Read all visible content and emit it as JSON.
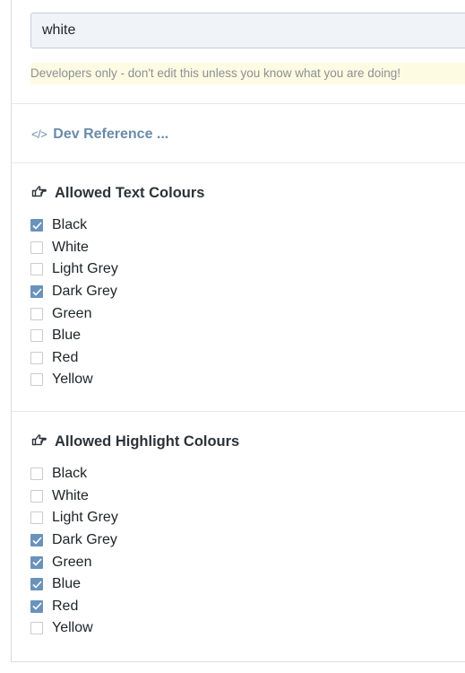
{
  "field": {
    "value": "white",
    "developer_note": "Developers only - don't edit this unless you know what you are doing!"
  },
  "dev_reference": {
    "icon": "code-icon",
    "glyph": "</>",
    "label": "Dev Reference ..."
  },
  "text_colours": {
    "icon": "hand-pointing-icon",
    "title": "Allowed Text Colours",
    "options": [
      {
        "label": "Black",
        "checked": true
      },
      {
        "label": "White",
        "checked": false
      },
      {
        "label": "Light Grey",
        "checked": false
      },
      {
        "label": "Dark Grey",
        "checked": true
      },
      {
        "label": "Green",
        "checked": false
      },
      {
        "label": "Blue",
        "checked": false
      },
      {
        "label": "Red",
        "checked": false
      },
      {
        "label": "Yellow",
        "checked": false
      }
    ]
  },
  "highlight_colours": {
    "icon": "hand-pointing-icon",
    "title": "Allowed Highlight Colours",
    "options": [
      {
        "label": "Black",
        "checked": false
      },
      {
        "label": "White",
        "checked": false
      },
      {
        "label": "Light Grey",
        "checked": false
      },
      {
        "label": "Dark Grey",
        "checked": true
      },
      {
        "label": "Green",
        "checked": true
      },
      {
        "label": "Blue",
        "checked": true
      },
      {
        "label": "Red",
        "checked": true
      },
      {
        "label": "Yellow",
        "checked": false
      }
    ]
  },
  "colors": {
    "accent": "#6a93bc",
    "note_background": "#fefbe3",
    "link": "#6a8bab"
  }
}
